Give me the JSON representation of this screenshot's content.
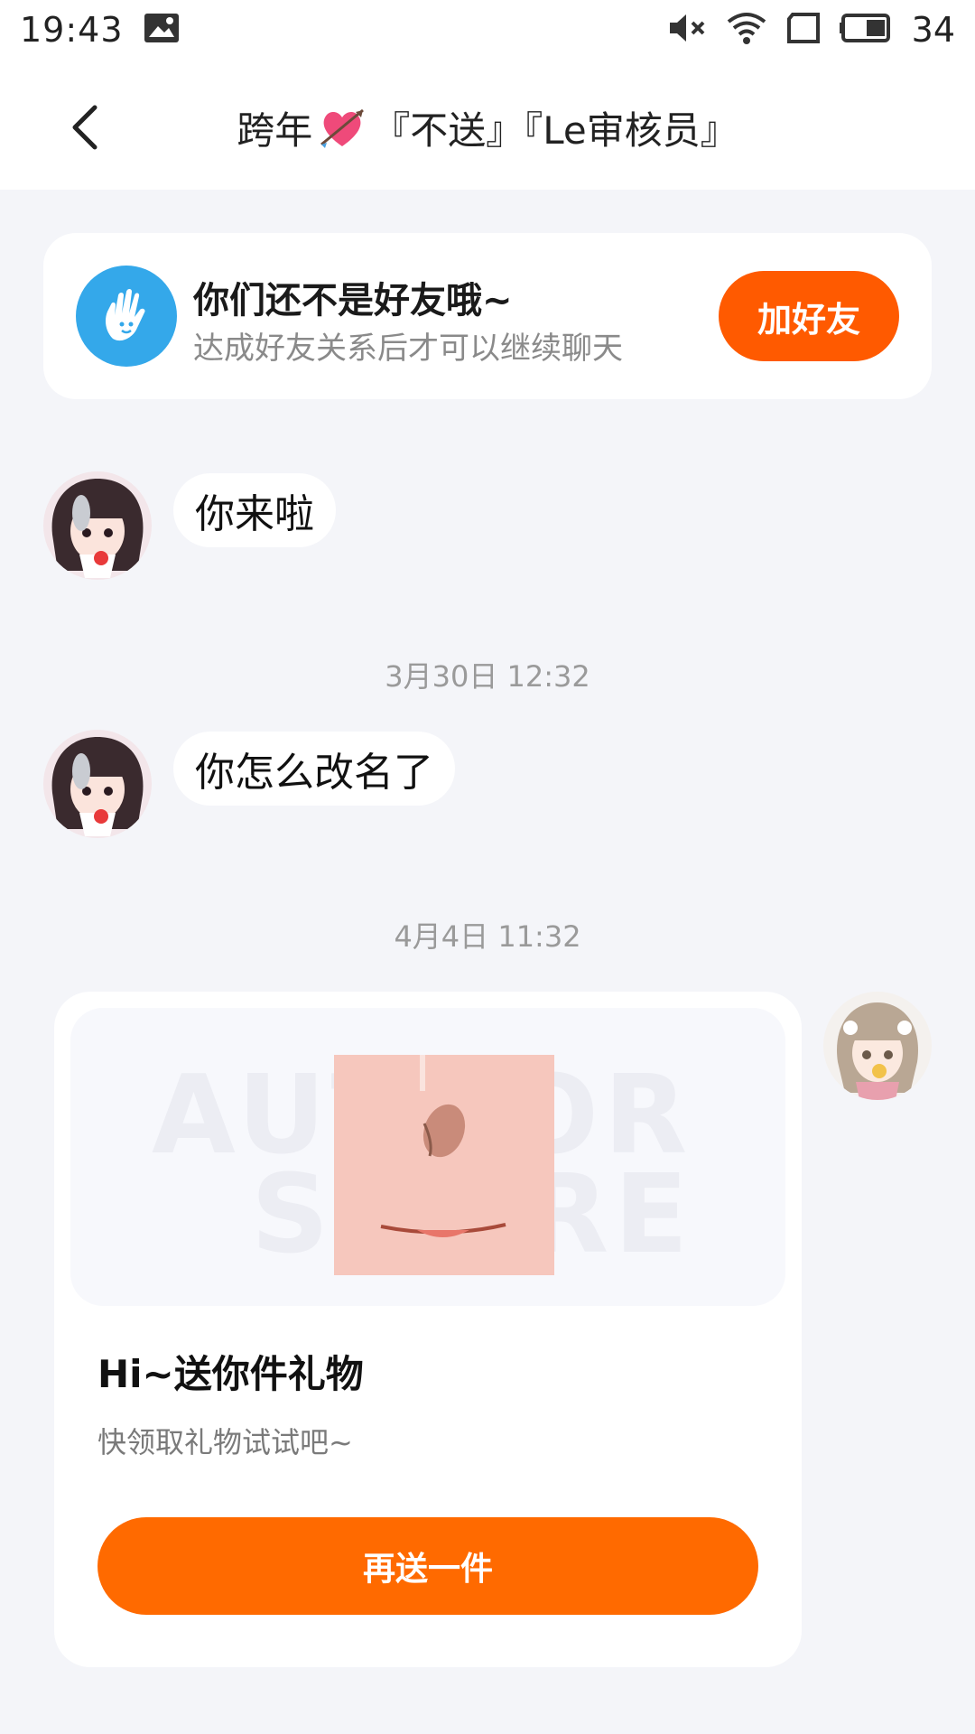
{
  "status_bar": {
    "time": "19:43",
    "battery": "34",
    "icons": [
      "image-notification-icon",
      "mute-icon",
      "wifi-icon",
      "screen-icon",
      "battery-icon"
    ]
  },
  "header": {
    "title_prefix": "跨年",
    "title_suffix": "『不送』『Le审核员』",
    "back_icon": "chevron-left-icon"
  },
  "friend_notice": {
    "title": "你们还不是好友哦~",
    "subtitle": "达成好友关系后才可以继续聊天",
    "button": "加好友",
    "accent": "#ff5a00"
  },
  "messages": [
    {
      "sender": "other",
      "text": "你来啦"
    },
    {
      "timestamp": "3月30日 12:32"
    },
    {
      "sender": "other",
      "text": "你怎么改名了"
    },
    {
      "timestamp": "4月4日 11:32"
    }
  ],
  "gift_card": {
    "title": "Hi~送你件礼物",
    "subtitle": "快领取礼物试试吧~",
    "button": "再送一件",
    "watermark_line1": "AUTHOR",
    "watermark_line2": "SQURE",
    "accent": "#ff6a00"
  }
}
